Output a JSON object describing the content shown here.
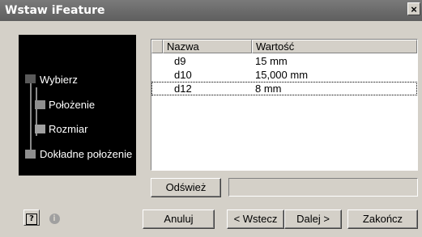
{
  "window": {
    "title": "Wstaw iFeature",
    "close_glyph": "×"
  },
  "steps": [
    {
      "label": "Wybierz",
      "state": "done"
    },
    {
      "label": "Położenie",
      "state": "pending"
    },
    {
      "label": "Rozmiar",
      "state": "current"
    },
    {
      "label": "Dokładne położenie",
      "state": "pending"
    }
  ],
  "table": {
    "columns": [
      "Nazwa",
      "Wartość"
    ],
    "rows": [
      {
        "name": "d9",
        "value": "15 mm"
      },
      {
        "name": "d10",
        "value": "15,000 mm"
      },
      {
        "name": "d12",
        "value": "8 mm"
      }
    ]
  },
  "refresh": {
    "label": "Odśwież",
    "field_value": ""
  },
  "buttons": {
    "cancel": "Anuluj",
    "back": "< Wstecz",
    "next": "Dalej >",
    "finish": "Zakończ"
  },
  "colors": {
    "node_done": "#5a5a5a",
    "node_pending": "#8f8f8f",
    "node_current": "#a0a0a0"
  }
}
